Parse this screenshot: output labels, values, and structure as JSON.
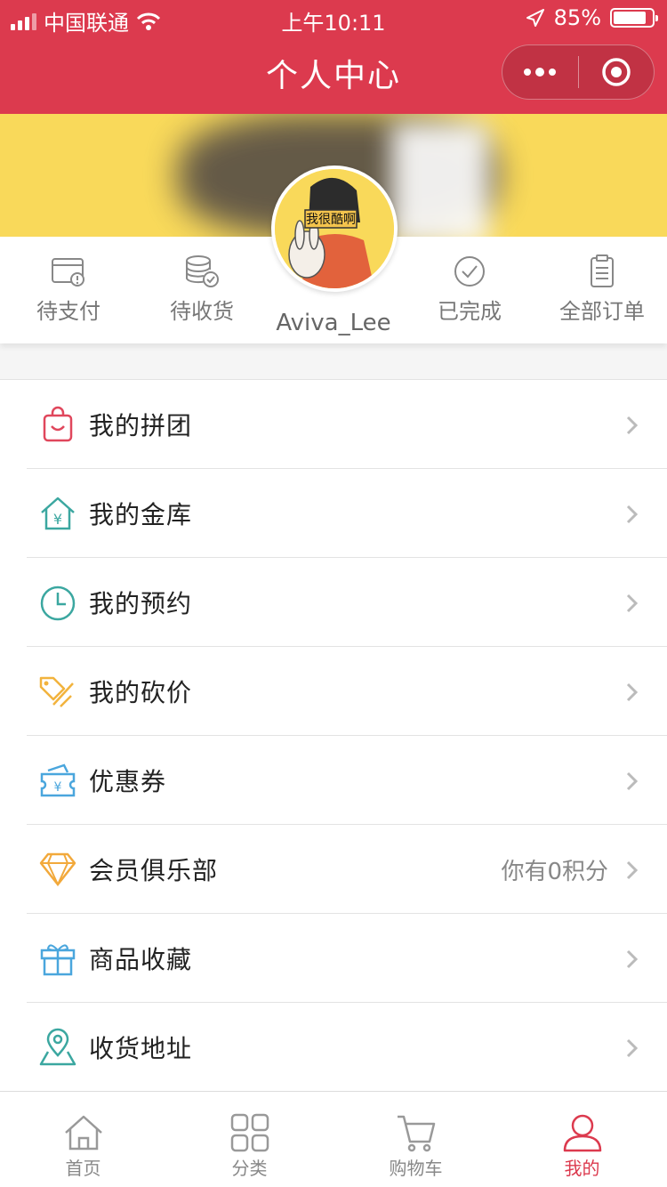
{
  "status_bar": {
    "carrier": "中国联通",
    "time": "上午10:11",
    "battery": "85%"
  },
  "nav": {
    "title": "个人中心"
  },
  "user": {
    "name": "Aviva_Lee",
    "avatar_text": "我很酷啊"
  },
  "orders": [
    {
      "label": "待支付",
      "icon": "wallet-icon"
    },
    {
      "label": "待收货",
      "icon": "coins-check-icon"
    },
    {
      "label": "已完成",
      "icon": "check-circle-icon"
    },
    {
      "label": "全部订单",
      "icon": "clipboard-icon"
    }
  ],
  "menu": [
    {
      "label": "我的拼团",
      "icon": "shopping-bag-icon",
      "color": "#e0475c"
    },
    {
      "label": "我的金库",
      "icon": "vault-house-icon",
      "color": "#3ba7a0"
    },
    {
      "label": "我的预约",
      "icon": "clock-icon",
      "color": "#3ba7a0"
    },
    {
      "label": "我的砍价",
      "icon": "price-tag-icon",
      "color": "#f2b33d"
    },
    {
      "label": "优惠券",
      "icon": "coupon-icon",
      "color": "#4aa6dd"
    },
    {
      "label": "会员俱乐部",
      "icon": "diamond-icon",
      "color": "#f2a93b",
      "extra": "你有0积分"
    },
    {
      "label": "商品收藏",
      "icon": "gift-icon",
      "color": "#4aa6dd"
    },
    {
      "label": "收货地址",
      "icon": "map-pin-icon",
      "color": "#3ba7a0"
    }
  ],
  "tabs": [
    {
      "label": "首页",
      "icon": "home-icon"
    },
    {
      "label": "分类",
      "icon": "grid-icon"
    },
    {
      "label": "购物车",
      "icon": "cart-icon"
    },
    {
      "label": "我的",
      "icon": "user-icon",
      "active": true
    }
  ],
  "colors": {
    "brand": "#dc3a4e",
    "banner": "#f9d95a"
  }
}
